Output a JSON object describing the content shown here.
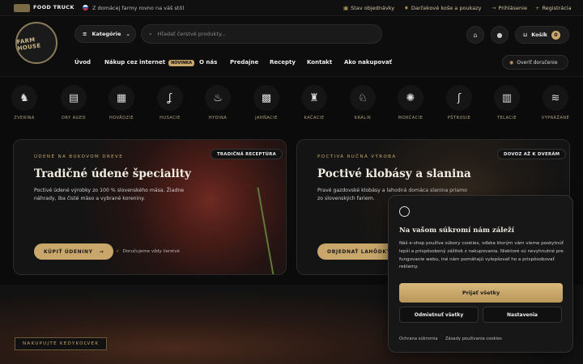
{
  "topbar": {
    "brand": "FOOD TRUCK",
    "slogan": "Z domácej farmy rovno na váš stôl",
    "order_status": "Stav objednávky",
    "gift_baskets": "Darčekové koše a poukazy",
    "login": "Prihlásenie",
    "register": "Registrácia"
  },
  "header": {
    "logo_text": "FARM HOUSE",
    "categories_label": "Kategórie",
    "search_placeholder": "Hľadať čerstvé produkty...",
    "cart_label": "Košík",
    "cart_count": "0",
    "verify_delivery": "Overiť doručenie"
  },
  "nav": {
    "items": [
      "Úvod",
      "Nákup cez internet",
      "O nás",
      "Predajne",
      "Recepty",
      "Kontakt",
      "Ako nakupovať"
    ],
    "new_badge": "NOVINKA"
  },
  "categories": [
    {
      "label": "ZVERINA",
      "icon": "deer-icon"
    },
    {
      "label": "DRY AGED",
      "icon": "meat-cut-icon"
    },
    {
      "label": "HOVÄDZIE",
      "icon": "cow-icon"
    },
    {
      "label": "HUSACIE",
      "icon": "goose-icon"
    },
    {
      "label": "HYDINA",
      "icon": "chicken-icon"
    },
    {
      "label": "JAHŇACIE",
      "icon": "lamb-icon"
    },
    {
      "label": "KAČACIE",
      "icon": "duck-icon"
    },
    {
      "label": "KRÁLIK",
      "icon": "rabbit-icon"
    },
    {
      "label": "MORČACIE",
      "icon": "turkey-icon"
    },
    {
      "label": "PŠTROSIE",
      "icon": "ostrich-icon"
    },
    {
      "label": "TELACIE",
      "icon": "calf-icon"
    },
    {
      "label": "VYPRÁŽANÉ",
      "icon": "fried-icon"
    }
  ],
  "cards": [
    {
      "kicker": "ÚDENÉ NA BUKOVOM DREVE",
      "tag": "TRADIČNÁ RECEPTÚRA",
      "title": "Tradičné údené špeciality",
      "desc": "Poctivé údené výrobky zo 100 % slovenského mäsa. Žiadne náhrady, iba čisté mäso a vybrané koreniny.",
      "cta": "KÚPIŤ ÚDENINY",
      "note": "Doručujeme vždy čerstvé"
    },
    {
      "kicker": "POCTIVÁ RUČNÁ VÝROBA",
      "tag": "DOVOZ AŽ K DVERÁM",
      "title": "Poctivé klobásy a slanina",
      "desc": "Pravé gazdovské klobásy a lahodná domáca slanina priamo zo slovenských fariem.",
      "cta": "OBJEDNAŤ LAHÔDKY"
    }
  ],
  "voucher_button": "NAKUPUJTE KEDYKOĽVEK",
  "cookie": {
    "title": "Na vašom súkromí nám záleží",
    "text": "Náš e-shop používa súbory cookies, vďaka ktorým vám vieme poskytnúť lepší a prispôsobený zážitok z nakupovania. Niektoré sú nevyhnutné pre fungovanie webu, iné nám pomáhajú vylepšovať ho a prispôsobovať reklamy.",
    "accept_all": "Prijať všetky",
    "reject_all": "Odmietnuť všetky",
    "settings": "Nastavenia",
    "privacy_link": "Ochrana súkromia",
    "cookie_rules_link": "Zásady používania cookies"
  },
  "colors": {
    "accent": "#c9a76a",
    "background": "#0b0b0b"
  }
}
